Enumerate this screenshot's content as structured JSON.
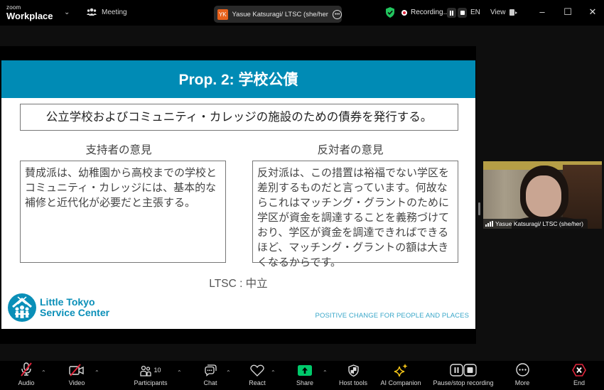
{
  "app": {
    "brand_small": "zoom",
    "brand_name": "Workplace",
    "meeting_label": "Meeting"
  },
  "share_indicator": {
    "initials": "YK",
    "initials_color": "#e8621c",
    "name": "Yasue Katsuragi/ LTSC (she/her)'s"
  },
  "status": {
    "security_color": "#22c55e",
    "recording_label": "Recording...",
    "language": "EN",
    "view_label": "View"
  },
  "slide": {
    "title": "Prop. 2: 学校公債",
    "header_color": "#008bb5",
    "summary": "公立学校およびコミュニティ・カレッジの施設のための債券を発行する。",
    "supporters_title": "支持者の意見",
    "supporters_text": "賛成派は、幼稚園から高校までの学校とコミュニティ・カレッジには、基本的な補修と近代化が必要だと主張する。",
    "opponents_title": "反対者の意見",
    "opponents_text": "反対派は、この措置は裕福でない学区を差別するものだと言っています。何故ならこれはマッチング・グラントのために学区が資金を調達することを義務づけており、学区が資金を調達できればできるほど、マッチング・グラントの額は大きくなるからです。",
    "verdict": "LTSC : 中立",
    "logo_line1": "Little Tokyo",
    "logo_line2": "Service Center",
    "tagline": "POSITIVE CHANGE FOR PEOPLE AND PLACES"
  },
  "participant_video": {
    "name": "Yasue Katsuragi/ LTSC (she/her)"
  },
  "toolbar": {
    "audio": "Audio",
    "video": "Video",
    "participants": "Participants",
    "participants_count": "10",
    "chat": "Chat",
    "react": "React",
    "share": "Share",
    "share_color": "#00c96b",
    "host_tools": "Host tools",
    "ai_companion": "AI Companion",
    "ai_color": "#f5c518",
    "pause_stop_recording": "Pause/stop recording",
    "more": "More",
    "end": "End",
    "end_color": "#e0243a"
  }
}
